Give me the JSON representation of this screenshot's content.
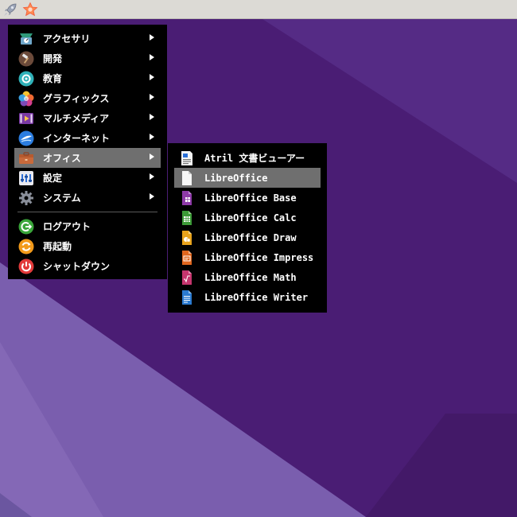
{
  "colors": {
    "desktop_purple": "#4a1d74",
    "highlight": "#6f6f6f",
    "menu_bg": "#000000"
  },
  "taskbar": {
    "launcher_icon": "rocket-icon",
    "favorites_icon": "star-icon"
  },
  "main_menu": {
    "categories": [
      {
        "label": "アクセサリ",
        "icon": "accessories-icon"
      },
      {
        "label": "開発",
        "icon": "hammer-icon"
      },
      {
        "label": "教育",
        "icon": "education-icon"
      },
      {
        "label": "グラフィックス",
        "icon": "graphics-icon"
      },
      {
        "label": "マルチメディア",
        "icon": "multimedia-icon"
      },
      {
        "label": "インターネット",
        "icon": "internet-icon"
      },
      {
        "label": "オフィス",
        "icon": "office-icon"
      },
      {
        "label": "設定",
        "icon": "settings-icon"
      },
      {
        "label": "システム",
        "icon": "gear-icon"
      }
    ],
    "session": [
      {
        "label": "ログアウト",
        "icon": "logout-icon"
      },
      {
        "label": "再起動",
        "icon": "restart-icon"
      },
      {
        "label": "シャットダウン",
        "icon": "power-icon"
      }
    ]
  },
  "office_submenu": {
    "items": [
      {
        "label": "Atril 文書ビューアー",
        "icon": "document-viewer-icon"
      },
      {
        "label": "LibreOffice",
        "icon": "libreoffice-icon"
      },
      {
        "label": "LibreOffice Base",
        "icon": "libreoffice-base-icon"
      },
      {
        "label": "LibreOffice Calc",
        "icon": "libreoffice-calc-icon"
      },
      {
        "label": "LibreOffice Draw",
        "icon": "libreoffice-draw-icon"
      },
      {
        "label": "LibreOffice Impress",
        "icon": "libreoffice-impress-icon"
      },
      {
        "label": "LibreOffice Math",
        "icon": "libreoffice-math-icon"
      },
      {
        "label": "LibreOffice Writer",
        "icon": "libreoffice-writer-icon"
      }
    ]
  }
}
